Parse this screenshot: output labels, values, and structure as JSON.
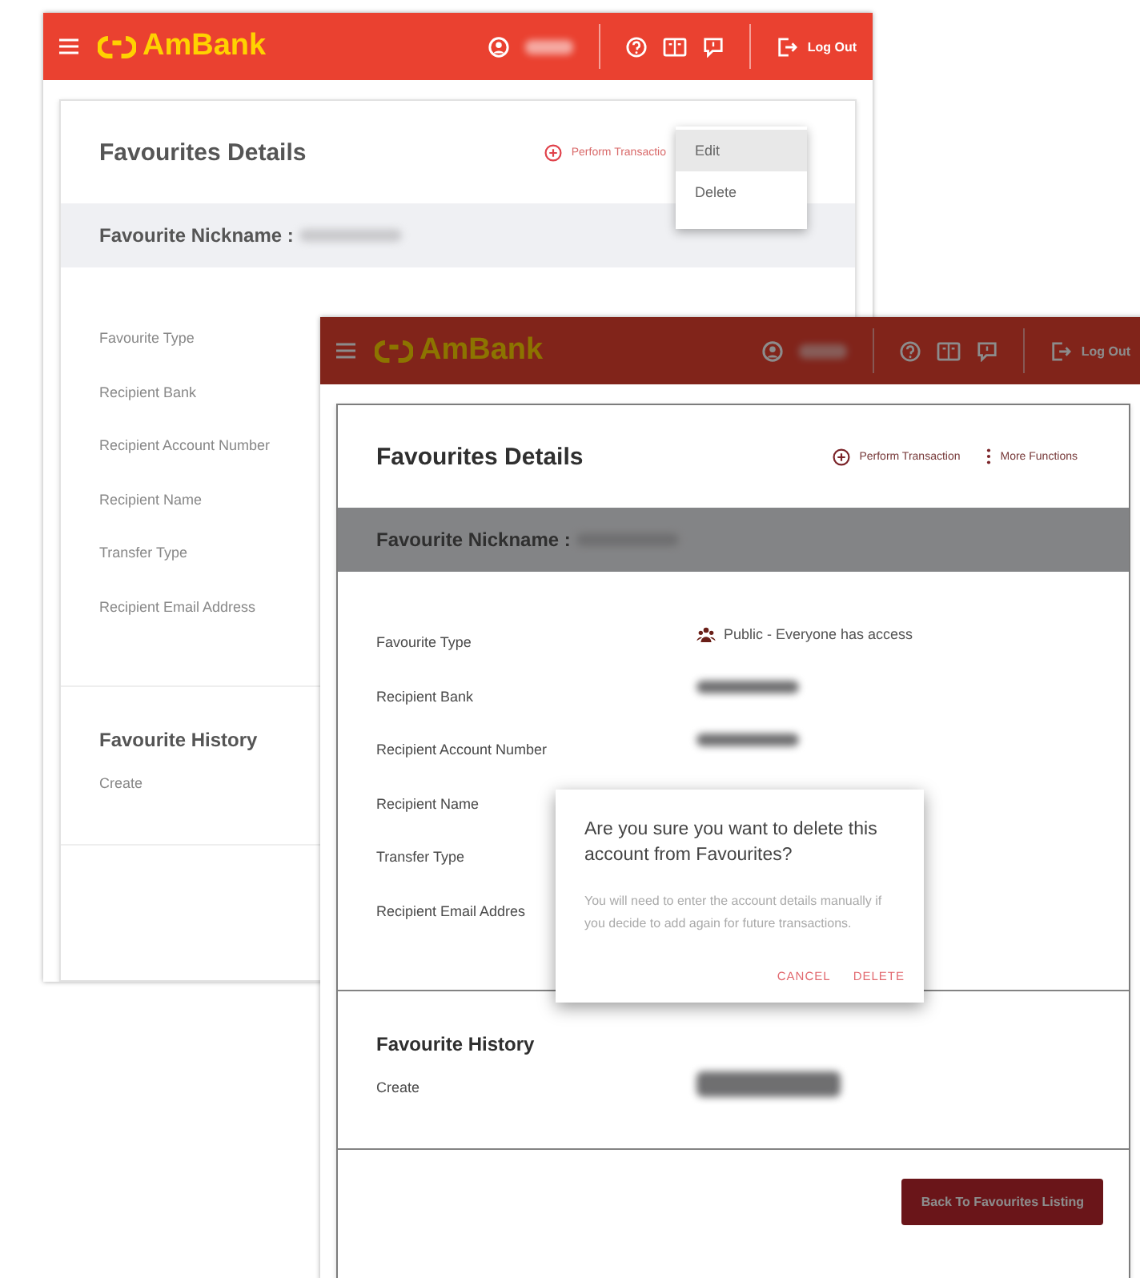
{
  "windows": [
    {
      "kind": "behind",
      "header": {
        "logo": "AmBank",
        "logout": "Log Out"
      },
      "title": "Favourites Details",
      "actions": [
        {
          "kind": "add",
          "label": "Perform Transactio"
        }
      ],
      "menu": [
        {
          "label": "Edit",
          "selected": true
        },
        {
          "label": "Delete",
          "selected": false
        }
      ],
      "nickname_label": "Favourite Nickname :",
      "fields": [
        {
          "label": "Favourite Type"
        },
        {
          "label": "Recipient Bank"
        },
        {
          "label": "Recipient Account Number"
        },
        {
          "label": "Recipient Name"
        },
        {
          "label": "Transfer Type"
        },
        {
          "label": "Recipient Email Address"
        }
      ],
      "history_title": "Favourite History",
      "history": [
        {
          "label": "Create"
        }
      ]
    },
    {
      "kind": "front",
      "dimmed": true,
      "header": {
        "logo": "AmBank",
        "logout": "Log Out"
      },
      "title": "Favourites Details",
      "actions": [
        {
          "kind": "add",
          "label": "Perform Transaction"
        },
        {
          "kind": "more",
          "label": "More Functions"
        }
      ],
      "nickname_label": "Favourite Nickname :",
      "fields": [
        {
          "label": "Favourite Type",
          "value": "Public - Everyone has access"
        },
        {
          "label": "Recipient Bank",
          "redacted": true
        },
        {
          "label": "Recipient Account Number",
          "redacted": true
        },
        {
          "label": "Recipient Name"
        },
        {
          "label": "Transfer Type"
        },
        {
          "label": "Recipient Email Addres"
        }
      ],
      "history_title": "Favourite History",
      "history": [
        {
          "label": "Create",
          "redacted": true
        }
      ],
      "footer_button": "Back To Favourites Listing",
      "dialog": {
        "title": "Are you sure you want to delete this account from Favourites?",
        "body": "You will need to enter the account details manually if you decide to add again for future transactions.",
        "buttons": [
          "CANCEL",
          "DELETE"
        ]
      }
    }
  ]
}
